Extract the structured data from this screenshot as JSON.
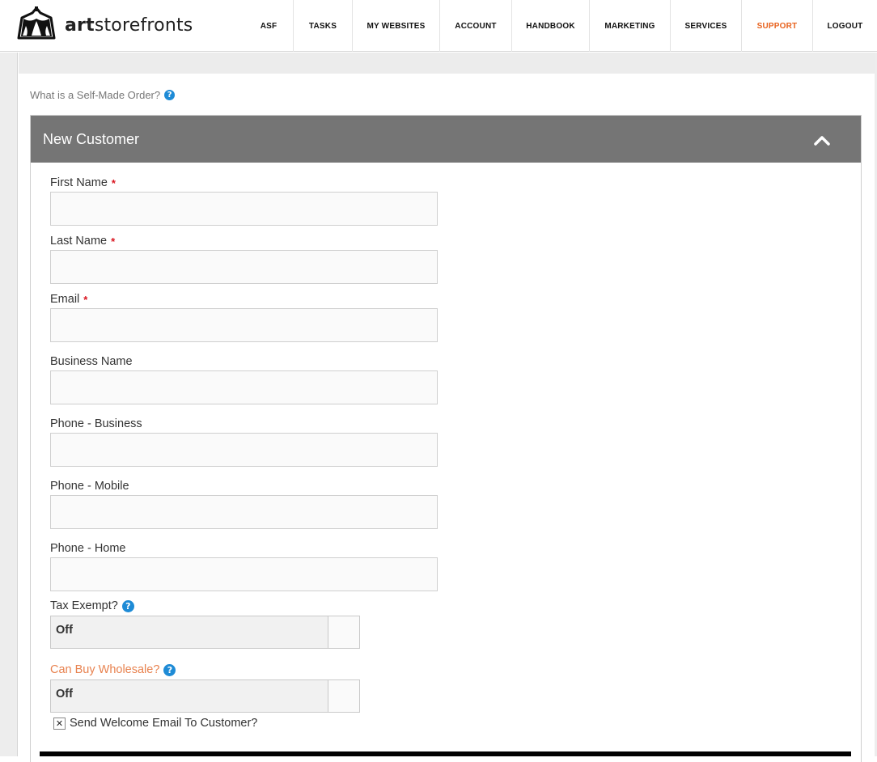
{
  "brand": {
    "logo_text_bold": "art",
    "logo_text_rest": "storefronts"
  },
  "nav": [
    {
      "label": "ASF"
    },
    {
      "label": "TASKS"
    },
    {
      "label": "MY WEBSITES"
    },
    {
      "label": "ACCOUNT"
    },
    {
      "label": "HANDBOOK"
    },
    {
      "label": "MARKETING"
    },
    {
      "label": "SERVICES"
    },
    {
      "label": "SUPPORT"
    },
    {
      "label": "LOGOUT"
    }
  ],
  "help": {
    "text": "What is a Self-Made Order?",
    "icon": "question-circle-icon"
  },
  "panel": {
    "title": "New Customer",
    "collapse_icon": "chevron-up-icon"
  },
  "form": {
    "first_name": {
      "label": "First Name",
      "required_mark": "*",
      "value": ""
    },
    "last_name": {
      "label": "Last Name",
      "required_mark": "*",
      "value": ""
    },
    "email": {
      "label": "Email",
      "required_mark": "*",
      "value": ""
    },
    "business_name": {
      "label": "Business Name",
      "value": ""
    },
    "phone_business": {
      "label": "Phone - Business",
      "value": ""
    },
    "phone_mobile": {
      "label": "Phone - Mobile",
      "value": ""
    },
    "phone_home": {
      "label": "Phone - Home",
      "value": ""
    },
    "tax_exempt": {
      "label": "Tax Exempt?",
      "value": "Off"
    },
    "can_buy_wholesale": {
      "label": "Can Buy Wholesale?",
      "value": "Off"
    },
    "send_welcome": {
      "label": "Send Welcome Email To Customer?",
      "checked": true,
      "mark": "✕"
    }
  },
  "colors": {
    "accent_orange": "#e8631f",
    "help_blue": "#1e8bd6",
    "panel_header": "#757575",
    "required_red": "#d9141f"
  }
}
